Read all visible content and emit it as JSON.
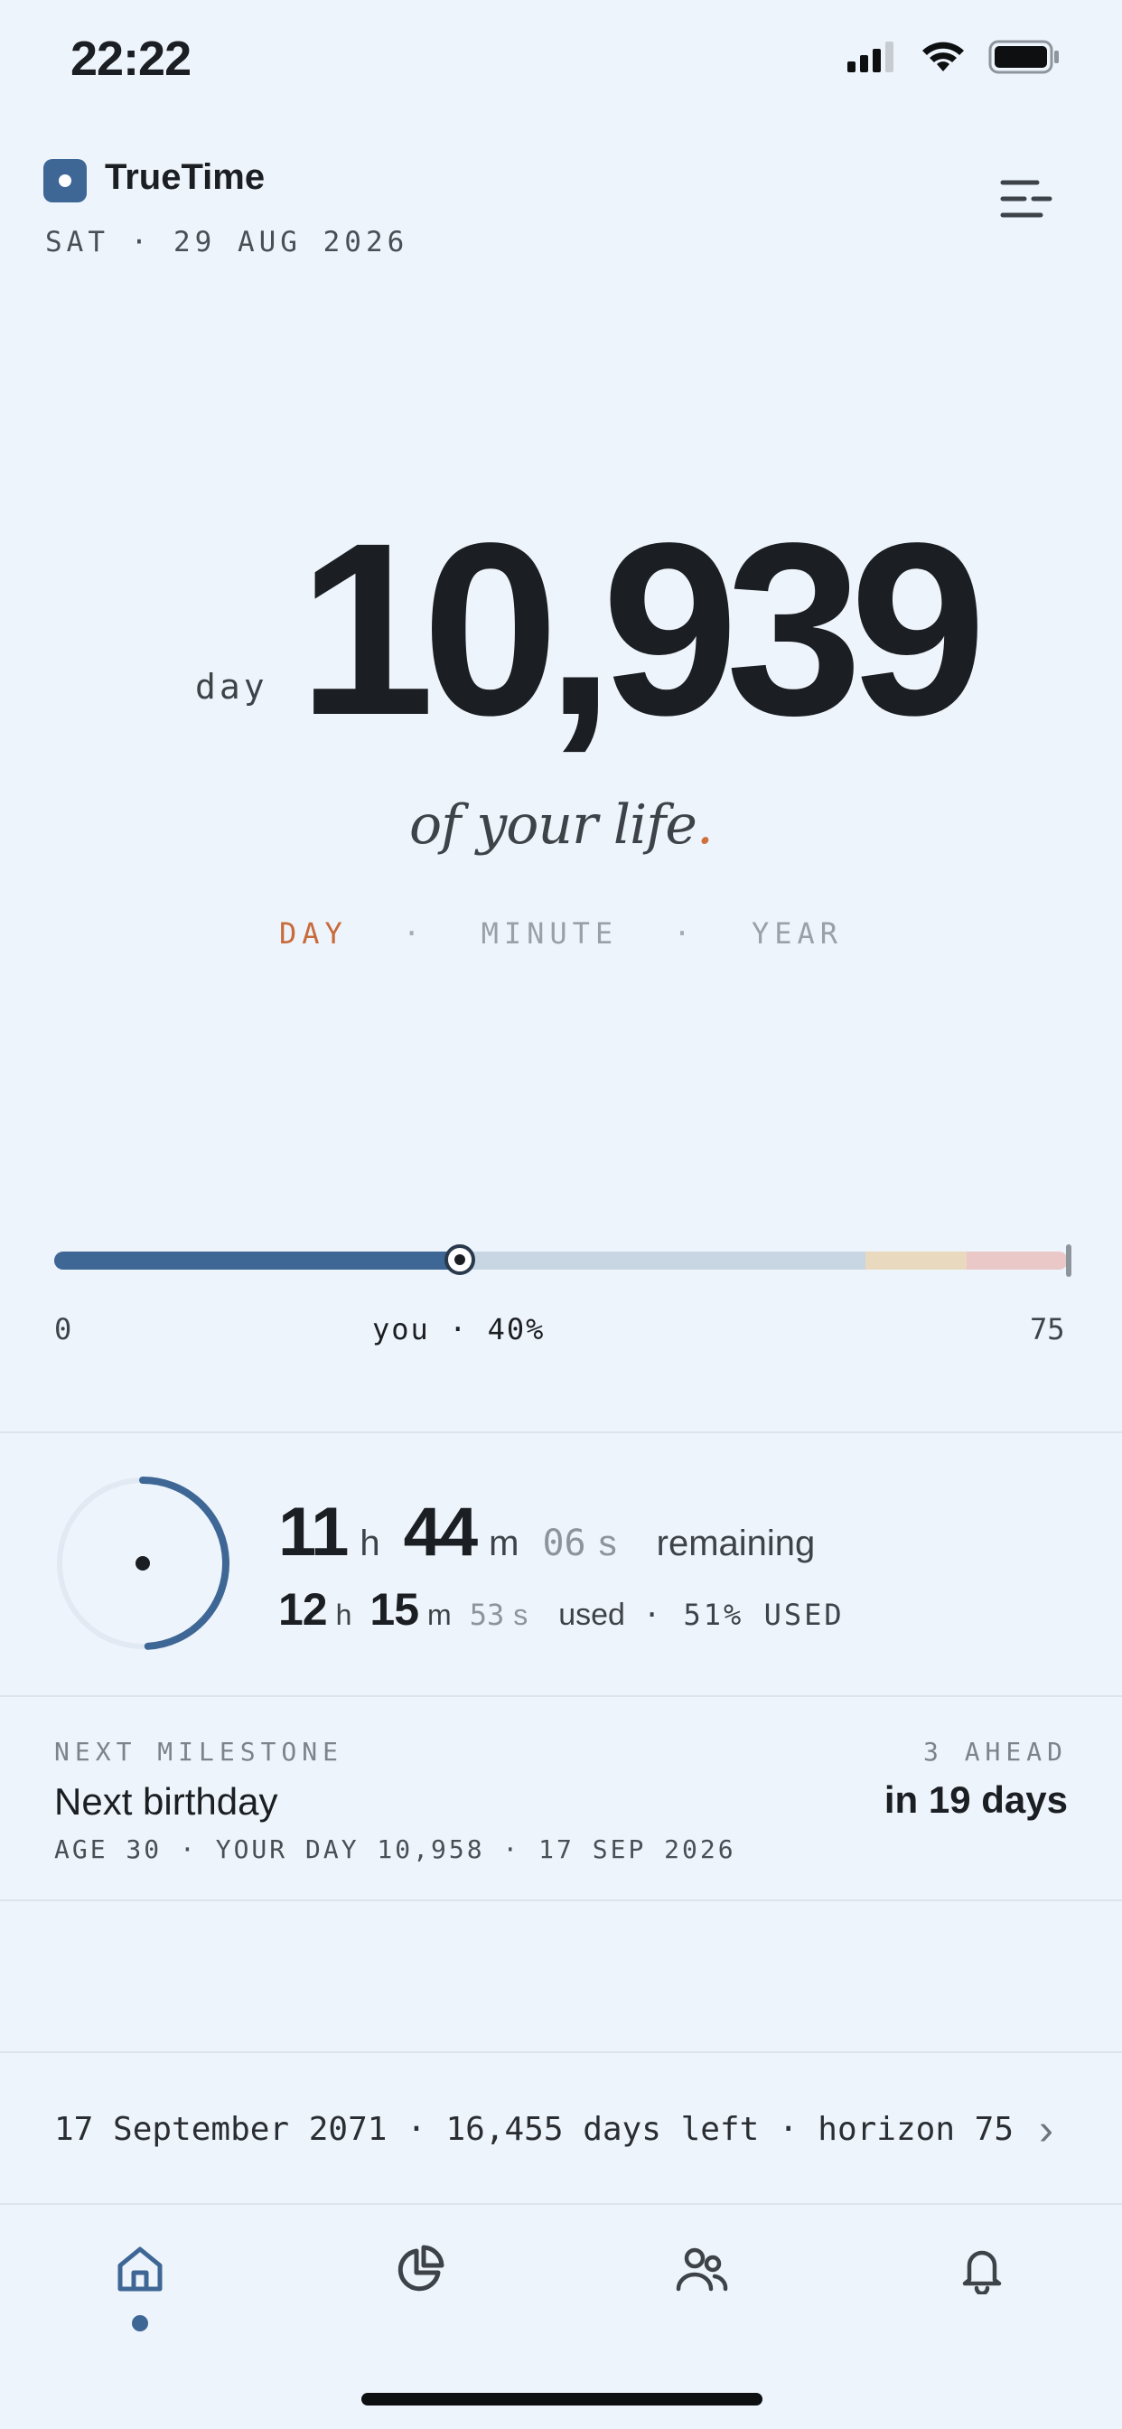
{
  "status_bar": {
    "time": "22:22"
  },
  "header": {
    "app_name": "TrueTime",
    "date": "SAT · 29 AUG 2026"
  },
  "counter": {
    "unit_label": "day",
    "value": "10,939",
    "tagline": "of your life",
    "tagline_dot": ".",
    "units": [
      {
        "label": "DAY",
        "active": true
      },
      {
        "label": "MINUTE",
        "active": false
      },
      {
        "label": "YEAR",
        "active": false
      }
    ],
    "unit_separator": "·"
  },
  "life_bar": {
    "min_label": "0",
    "max_label": "75",
    "you_label": "you · 40%",
    "progress_fraction": 0.4,
    "warn_start_fraction": 0.8,
    "late_start_fraction": 0.9
  },
  "day_clock": {
    "remaining_hours": "11",
    "remaining_minutes": "44",
    "remaining_seconds": "06",
    "used_hours": "12",
    "used_minutes": "15",
    "used_seconds": "53",
    "h_unit": "h",
    "m_unit": "m",
    "s_unit": "s",
    "remaining_word": "remaining",
    "used_word": "used",
    "used_percent": "· 51% USED",
    "used_fraction": 0.51
  },
  "milestone": {
    "label": "NEXT MILESTONE",
    "ahead": "3 AHEAD",
    "title": "Next birthday",
    "when": "in 19 days",
    "detail": "AGE 30 · YOUR DAY 10,958 · 17 SEP 2026"
  },
  "horizon": {
    "text": "17 September 2071 · 16,455 days left · horizon 75"
  },
  "tab_bar": {
    "tabs": [
      {
        "name": "home",
        "icon": "home-icon",
        "active": true
      },
      {
        "name": "stats",
        "icon": "pie-chart-icon",
        "active": false
      },
      {
        "name": "people",
        "icon": "people-icon",
        "active": false
      },
      {
        "name": "alerts",
        "icon": "bell-icon",
        "active": false
      }
    ]
  },
  "colors": {
    "accent": "#3E6796",
    "highlight": "#C86A3A",
    "background": "#EEF4FB",
    "text": "#1B1E22"
  }
}
